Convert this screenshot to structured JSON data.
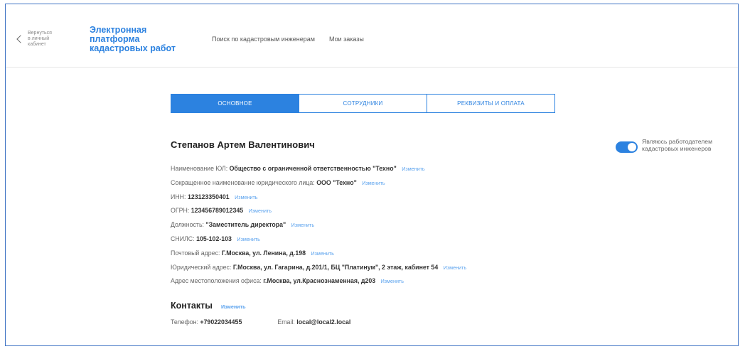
{
  "header": {
    "back_line1": "Вернуться",
    "back_line2": "в личный кабинет",
    "brand_line1": "Электронная платформа",
    "brand_line2": "кадастровых работ",
    "nav": [
      "Поиск по кадастровым инженерам",
      "Мои заказы"
    ]
  },
  "tabs": [
    {
      "label": "ОСНОВНОЕ",
      "active": true
    },
    {
      "label": "СОТРУДНИКИ",
      "active": false
    },
    {
      "label": "РЕКВИЗИТЫ И ОПЛАТА",
      "active": false
    }
  ],
  "profile": {
    "name": "Степанов Артем Валентинович",
    "edit_label": "Изменить",
    "fields": [
      {
        "label": "Наименование ЮЛ:",
        "value": "Общество с ограниченной ответственностью \"Техно\""
      },
      {
        "label": "Сокращенное наименование юридического лица:",
        "value": "ООО \"Техно\""
      },
      {
        "label": "ИНН:",
        "value": "123123350401"
      },
      {
        "label": "ОГРН:",
        "value": "123456789012345"
      },
      {
        "label": "Должность:",
        "value": "\"Заместитель директора\""
      },
      {
        "label": "СНИЛС:",
        "value": "105-102-103"
      },
      {
        "label": "Почтовый адрес:",
        "value": "Г.Москва, ул. Ленина, д.198"
      },
      {
        "label": "Юридический адрес:",
        "value": "Г.Москва, ул. Гагарина, д.201/1, БЦ \"Платинум\", 2 этаж, кабинет 54"
      },
      {
        "label": "Адрес местоположения офиса:",
        "value": "г.Москва, ул.Краснознаменная, д203"
      }
    ]
  },
  "employer_toggle": {
    "line1": "Являюсь работодателем",
    "line2": "кадастровых инженеров",
    "on": true
  },
  "contacts": {
    "title": "Контакты",
    "edit_label": "Изменить",
    "phone_label": "Телефон:",
    "phone": "+79022034455",
    "email_label": "Email:",
    "email": "local@local2.local"
  },
  "colors": {
    "accent": "#2c82e0",
    "link": "#5aa2ee",
    "frame": "#3f73c4"
  }
}
